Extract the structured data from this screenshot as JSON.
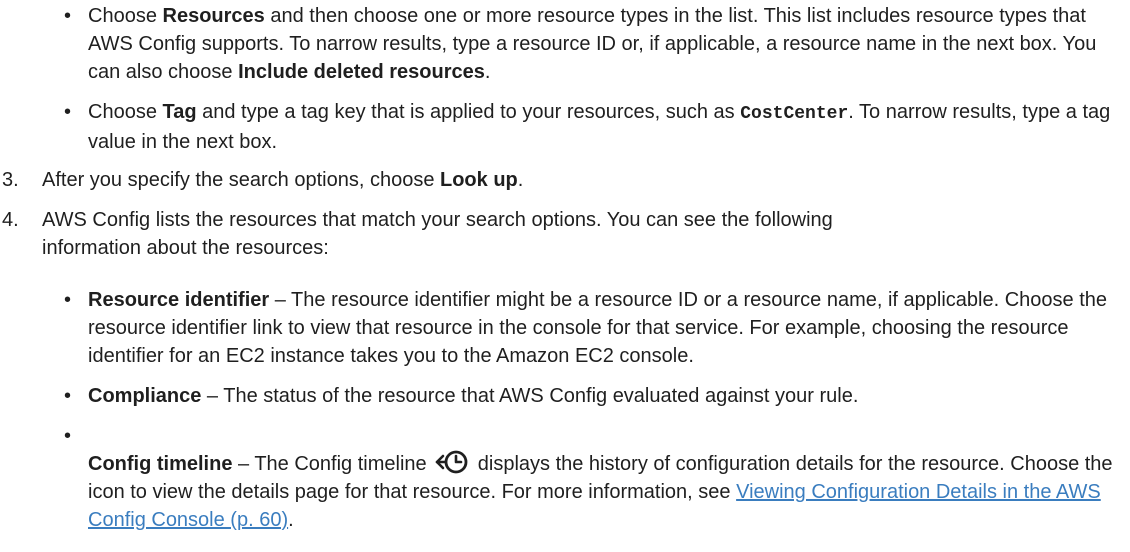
{
  "bullet_resources": {
    "pre": "Choose ",
    "bold1": "Resources",
    "mid": " and then choose one or more resource types in the list. This list includes resource types that AWS Config supports. To narrow results, type a resource ID or, if applicable, a resource name in the next box. You can also choose ",
    "bold2": "Include deleted resources",
    "post": "."
  },
  "bullet_tag": {
    "pre": "Choose ",
    "bold": "Tag",
    "mid": " and type a tag key that is applied to your resources, such as ",
    "code": "CostCenter",
    "post": ". To narrow results, type a tag value in the next box."
  },
  "step3": {
    "number": "3.",
    "pre": "After you specify the search options, choose ",
    "bold": "Look up",
    "post": "."
  },
  "step4": {
    "number": "4.",
    "text": "AWS Config lists the resources that match your search options. You can see the following information about the resources:"
  },
  "detail_items": {
    "resource_identifier": {
      "term": "Resource identifier",
      "text": " – The resource identifier might be a resource ID or a resource name, if applicable. Choose the resource identifier link to view that resource in the console for that service. For example, choosing the resource identifier for an EC2 instance takes you to the Amazon EC2 console."
    },
    "compliance": {
      "term": "Compliance",
      "text": " – The status of the resource that AWS Config evaluated against your rule."
    },
    "config_timeline": {
      "term": "Config timeline",
      "pre": " – The Config timeline ",
      "post": " displays the history of configuration details for the resource. Choose the icon to view the details page for that resource. For more information, see ",
      "link": "Viewing Configuration Details in the AWS Config Console (p. 60)",
      "end": "."
    }
  },
  "bullet_symbol": "•",
  "icons": {
    "timeline": "config-timeline-icon"
  },
  "colors": {
    "link": "#3a7dbf",
    "text": "#1f1f1f"
  }
}
